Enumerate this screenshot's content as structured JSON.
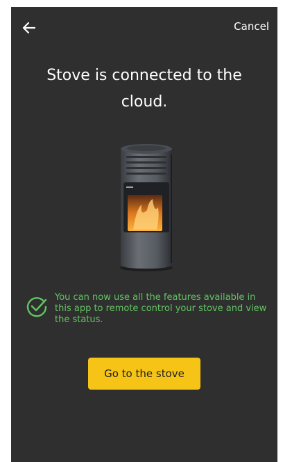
{
  "header": {
    "back_icon": "arrow-left-icon",
    "cancel_label": "Cancel"
  },
  "main": {
    "title": "Stove is connected to the cloud.",
    "status_icon": "check-circle-icon",
    "status_message": "You can now use all the features available in this app to remote control your stove and view the status.",
    "primary_button_label": "Go to the stove"
  },
  "colors": {
    "background": "#2f2f2f",
    "accent_yellow": "#f6c417",
    "success_green": "#62c462",
    "text_primary": "#ffffff"
  }
}
